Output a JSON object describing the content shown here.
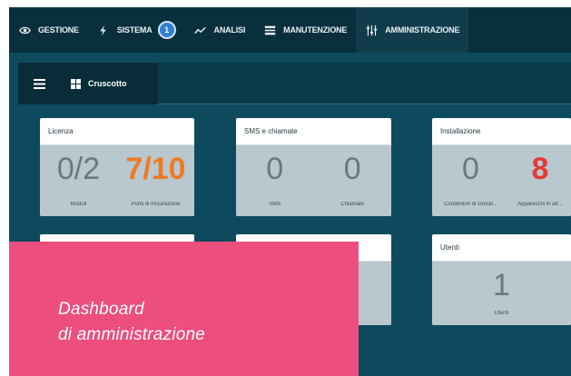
{
  "nav": {
    "items": [
      {
        "label": "GESTIONE",
        "icon": "eye-icon"
      },
      {
        "label": "SISTEMA",
        "icon": "bolt-icon",
        "badge": "1"
      },
      {
        "label": "ANALISI",
        "icon": "trend-icon"
      },
      {
        "label": "MANUTENZIONE",
        "icon": "list-icon"
      },
      {
        "label": "AMMINISTRAZIONE",
        "icon": "sliders-icon"
      }
    ]
  },
  "subbar": {
    "tab_label": "Cruscotto"
  },
  "cards": {
    "licenza": {
      "title": "Licenza",
      "m1_value": "0/2",
      "m1_caption": "Moduli",
      "m2_value": "7/10",
      "m2_caption": "Punti di misurazione"
    },
    "sms": {
      "title": "SMS e chiamate",
      "m1_value": "0",
      "m1_caption": "SMS",
      "m2_value": "0",
      "m2_caption": "Chiamate"
    },
    "installazione": {
      "title": "Installazione",
      "m1_value": "0",
      "m1_caption": "Contenitori di concili...",
      "m2_value": "8",
      "m2_caption": "Apparecchi in att..."
    },
    "utenti": {
      "title": "Utenti",
      "m1_value": "1",
      "m1_caption": "Utenti"
    }
  },
  "overlay": {
    "line1": "Dashboard",
    "line2": "di amministrazione"
  },
  "colors": {
    "accent_orange": "#f07a24",
    "accent_red": "#e53935",
    "overlay_pink": "#ec4e7e",
    "nav_bg": "#0a2f3c"
  }
}
